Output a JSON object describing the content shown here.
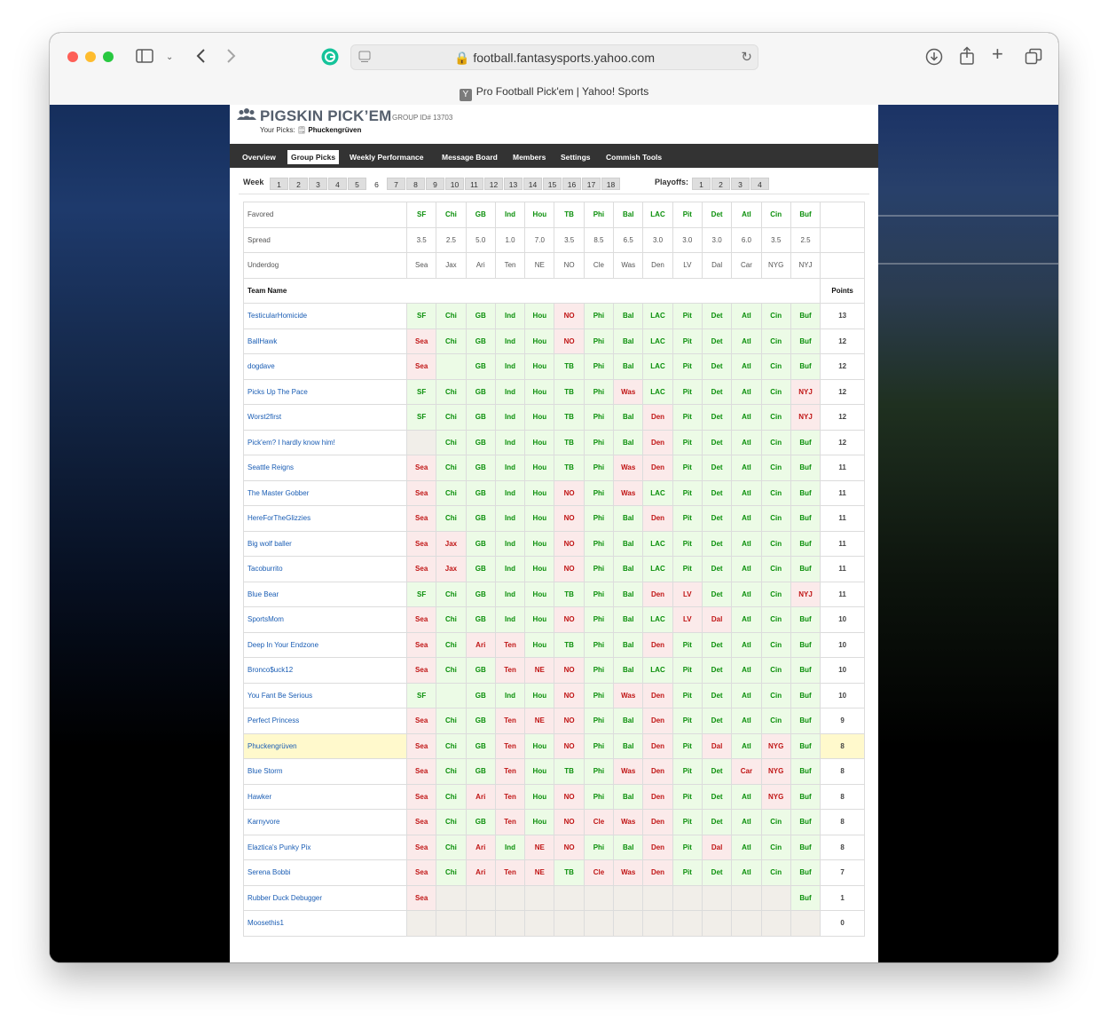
{
  "browser": {
    "url": "football.fantasysports.yahoo.com",
    "tab_title": "Pro Football Pick'em | Yahoo! Sports",
    "tab_favicon": "Y"
  },
  "header": {
    "title": "PIGSKIN PICK’EM",
    "group_id": "GROUP ID# 13703",
    "your_picks_label": "Your Picks:",
    "your_picks_name": "Phuckengrüven"
  },
  "nav": [
    "Overview",
    "Group Picks",
    "Weekly Performance",
    "Message Board",
    "Members",
    "Settings",
    "Commish Tools"
  ],
  "nav_active": "Group Picks",
  "weeks": {
    "label": "Week",
    "items": [
      "1",
      "2",
      "3",
      "4",
      "5",
      "6",
      "7",
      "8",
      "9",
      "10",
      "11",
      "12",
      "13",
      "14",
      "15",
      "16",
      "17",
      "18"
    ],
    "current": "6",
    "playoffs_label": "Playoffs:",
    "playoffs": [
      "1",
      "2",
      "3",
      "4"
    ]
  },
  "table": {
    "favored_label": "Favored",
    "spread_label": "Spread",
    "underdog_label": "Underdog",
    "team_name_header": "Team Name",
    "points_header": "Points",
    "favored": [
      "SF",
      "Chi",
      "GB",
      "Ind",
      "Hou",
      "TB",
      "Phi",
      "Bal",
      "LAC",
      "Pit",
      "Det",
      "Atl",
      "Cin",
      "Buf"
    ],
    "spread": [
      "3.5",
      "2.5",
      "5.0",
      "1.0",
      "7.0",
      "3.5",
      "8.5",
      "6.5",
      "3.0",
      "3.0",
      "3.0",
      "6.0",
      "3.5",
      "2.5"
    ],
    "underdog": [
      "Sea",
      "Jax",
      "Ari",
      "Ten",
      "NE",
      "NO",
      "Cle",
      "Was",
      "Den",
      "LV",
      "Dal",
      "Car",
      "NYG",
      "NYJ"
    ],
    "rows": [
      {
        "name": "TesticularHomicide",
        "points": "13",
        "picks": [
          "SF",
          "Chi",
          "GB",
          "Ind",
          "Hou",
          "NO",
          "Phi",
          "Bal",
          "LAC",
          "Pit",
          "Det",
          "Atl",
          "Cin",
          "Buf"
        ],
        "result": [
          "w",
          "w",
          "w",
          "w",
          "w",
          "l",
          "w",
          "w",
          "w",
          "w",
          "w",
          "w",
          "w",
          "w"
        ]
      },
      {
        "name": "BallHawk",
        "points": "12",
        "picks": [
          "Sea",
          "Chi",
          "GB",
          "Ind",
          "Hou",
          "NO",
          "Phi",
          "Bal",
          "LAC",
          "Pit",
          "Det",
          "Atl",
          "Cin",
          "Buf"
        ],
        "result": [
          "l",
          "w",
          "w",
          "w",
          "w",
          "l",
          "w",
          "w",
          "w",
          "w",
          "w",
          "w",
          "w",
          "w"
        ]
      },
      {
        "name": "dogdave",
        "points": "12",
        "picks": [
          "Sea",
          "",
          "GB",
          "Ind",
          "Hou",
          "TB",
          "Phi",
          "Bal",
          "LAC",
          "Pit",
          "Det",
          "Atl",
          "Cin",
          "Buf"
        ],
        "result": [
          "l",
          "w",
          "w",
          "w",
          "w",
          "w",
          "w",
          "w",
          "w",
          "w",
          "w",
          "w",
          "w",
          "w"
        ]
      },
      {
        "name": "Picks Up The Pace",
        "points": "12",
        "picks": [
          "SF",
          "Chi",
          "GB",
          "Ind",
          "Hou",
          "TB",
          "Phi",
          "Was",
          "LAC",
          "Pit",
          "Det",
          "Atl",
          "Cin",
          "NYJ"
        ],
        "result": [
          "w",
          "w",
          "w",
          "w",
          "w",
          "w",
          "w",
          "l",
          "w",
          "w",
          "w",
          "w",
          "w",
          "l"
        ]
      },
      {
        "name": "Worst2first",
        "points": "12",
        "picks": [
          "SF",
          "Chi",
          "GB",
          "Ind",
          "Hou",
          "TB",
          "Phi",
          "Bal",
          "Den",
          "Pit",
          "Det",
          "Atl",
          "Cin",
          "NYJ"
        ],
        "result": [
          "w",
          "w",
          "w",
          "w",
          "w",
          "w",
          "w",
          "w",
          "l",
          "w",
          "w",
          "w",
          "w",
          "l"
        ]
      },
      {
        "name": "Pick'em? I hardly know him!",
        "points": "12",
        "picks": [
          "",
          "Chi",
          "GB",
          "Ind",
          "Hou",
          "TB",
          "Phi",
          "Bal",
          "Den",
          "Pit",
          "Det",
          "Atl",
          "Cin",
          "Buf"
        ],
        "result": [
          "e",
          "w",
          "w",
          "w",
          "w",
          "w",
          "w",
          "w",
          "l",
          "w",
          "w",
          "w",
          "w",
          "w"
        ]
      },
      {
        "name": "Seattle Reigns",
        "points": "11",
        "picks": [
          "Sea",
          "Chi",
          "GB",
          "Ind",
          "Hou",
          "TB",
          "Phi",
          "Was",
          "Den",
          "Pit",
          "Det",
          "Atl",
          "Cin",
          "Buf"
        ],
        "result": [
          "l",
          "w",
          "w",
          "w",
          "w",
          "w",
          "w",
          "l",
          "l",
          "w",
          "w",
          "w",
          "w",
          "w"
        ]
      },
      {
        "name": "The Master Gobber",
        "points": "11",
        "picks": [
          "Sea",
          "Chi",
          "GB",
          "Ind",
          "Hou",
          "NO",
          "Phi",
          "Was",
          "LAC",
          "Pit",
          "Det",
          "Atl",
          "Cin",
          "Buf"
        ],
        "result": [
          "l",
          "w",
          "w",
          "w",
          "w",
          "l",
          "w",
          "l",
          "w",
          "w",
          "w",
          "w",
          "w",
          "w"
        ]
      },
      {
        "name": "HereForTheGlizzies",
        "points": "11",
        "picks": [
          "Sea",
          "Chi",
          "GB",
          "Ind",
          "Hou",
          "NO",
          "Phi",
          "Bal",
          "Den",
          "Pit",
          "Det",
          "Atl",
          "Cin",
          "Buf"
        ],
        "result": [
          "l",
          "w",
          "w",
          "w",
          "w",
          "l",
          "w",
          "w",
          "l",
          "w",
          "w",
          "w",
          "w",
          "w"
        ]
      },
      {
        "name": "Big wolf baller",
        "points": "11",
        "picks": [
          "Sea",
          "Jax",
          "GB",
          "Ind",
          "Hou",
          "NO",
          "Phi",
          "Bal",
          "LAC",
          "Pit",
          "Det",
          "Atl",
          "Cin",
          "Buf"
        ],
        "result": [
          "l",
          "l",
          "w",
          "w",
          "w",
          "l",
          "w",
          "w",
          "w",
          "w",
          "w",
          "w",
          "w",
          "w"
        ]
      },
      {
        "name": "Tacoburrito",
        "points": "11",
        "picks": [
          "Sea",
          "Jax",
          "GB",
          "Ind",
          "Hou",
          "NO",
          "Phi",
          "Bal",
          "LAC",
          "Pit",
          "Det",
          "Atl",
          "Cin",
          "Buf"
        ],
        "result": [
          "l",
          "l",
          "w",
          "w",
          "w",
          "l",
          "w",
          "w",
          "w",
          "w",
          "w",
          "w",
          "w",
          "w"
        ]
      },
      {
        "name": "Blue Bear",
        "points": "11",
        "picks": [
          "SF",
          "Chi",
          "GB",
          "Ind",
          "Hou",
          "TB",
          "Phi",
          "Bal",
          "Den",
          "LV",
          "Det",
          "Atl",
          "Cin",
          "NYJ"
        ],
        "result": [
          "w",
          "w",
          "w",
          "w",
          "w",
          "w",
          "w",
          "w",
          "l",
          "l",
          "w",
          "w",
          "w",
          "l"
        ]
      },
      {
        "name": "SportsMom",
        "points": "10",
        "picks": [
          "Sea",
          "Chi",
          "GB",
          "Ind",
          "Hou",
          "NO",
          "Phi",
          "Bal",
          "LAC",
          "LV",
          "Dal",
          "Atl",
          "Cin",
          "Buf"
        ],
        "result": [
          "l",
          "w",
          "w",
          "w",
          "w",
          "l",
          "w",
          "w",
          "w",
          "l",
          "l",
          "w",
          "w",
          "w"
        ]
      },
      {
        "name": "Deep In Your Endzone",
        "points": "10",
        "picks": [
          "Sea",
          "Chi",
          "Ari",
          "Ten",
          "Hou",
          "TB",
          "Phi",
          "Bal",
          "Den",
          "Pit",
          "Det",
          "Atl",
          "Cin",
          "Buf"
        ],
        "result": [
          "l",
          "w",
          "l",
          "l",
          "w",
          "w",
          "w",
          "w",
          "l",
          "w",
          "w",
          "w",
          "w",
          "w"
        ]
      },
      {
        "name": "Bronco$uck12",
        "points": "10",
        "picks": [
          "Sea",
          "Chi",
          "GB",
          "Ten",
          "NE",
          "NO",
          "Phi",
          "Bal",
          "LAC",
          "Pit",
          "Det",
          "Atl",
          "Cin",
          "Buf"
        ],
        "result": [
          "l",
          "w",
          "w",
          "l",
          "l",
          "l",
          "w",
          "w",
          "w",
          "w",
          "w",
          "w",
          "w",
          "w"
        ]
      },
      {
        "name": "You Fant Be Serious",
        "points": "10",
        "picks": [
          "SF",
          "",
          "GB",
          "Ind",
          "Hou",
          "NO",
          "Phi",
          "Was",
          "Den",
          "Pit",
          "Det",
          "Atl",
          "Cin",
          "Buf"
        ],
        "result": [
          "w",
          "w",
          "w",
          "w",
          "w",
          "l",
          "w",
          "l",
          "l",
          "w",
          "w",
          "w",
          "w",
          "w"
        ]
      },
      {
        "name": "Perfect Princess",
        "points": "9",
        "picks": [
          "Sea",
          "Chi",
          "GB",
          "Ten",
          "NE",
          "NO",
          "Phi",
          "Bal",
          "Den",
          "Pit",
          "Det",
          "Atl",
          "Cin",
          "Buf"
        ],
        "result": [
          "l",
          "w",
          "w",
          "l",
          "l",
          "l",
          "w",
          "w",
          "l",
          "w",
          "w",
          "w",
          "w",
          "w"
        ]
      },
      {
        "name": "Phuckengrüven",
        "points": "8",
        "me": true,
        "picks": [
          "Sea",
          "Chi",
          "GB",
          "Ten",
          "Hou",
          "NO",
          "Phi",
          "Bal",
          "Den",
          "Pit",
          "Dal",
          "Atl",
          "NYG",
          "Buf"
        ],
        "result": [
          "l",
          "w",
          "w",
          "l",
          "w",
          "l",
          "w",
          "w",
          "l",
          "w",
          "l",
          "w",
          "l",
          "w"
        ]
      },
      {
        "name": "Blue Storm",
        "points": "8",
        "picks": [
          "Sea",
          "Chi",
          "GB",
          "Ten",
          "Hou",
          "TB",
          "Phi",
          "Was",
          "Den",
          "Pit",
          "Det",
          "Car",
          "NYG",
          "Buf"
        ],
        "result": [
          "l",
          "w",
          "w",
          "l",
          "w",
          "w",
          "w",
          "l",
          "l",
          "w",
          "w",
          "l",
          "l",
          "w"
        ]
      },
      {
        "name": "Hawker",
        "points": "8",
        "picks": [
          "Sea",
          "Chi",
          "Ari",
          "Ten",
          "Hou",
          "NO",
          "Phi",
          "Bal",
          "Den",
          "Pit",
          "Det",
          "Atl",
          "NYG",
          "Buf"
        ],
        "result": [
          "l",
          "w",
          "l",
          "l",
          "w",
          "l",
          "w",
          "w",
          "l",
          "w",
          "w",
          "w",
          "l",
          "w"
        ]
      },
      {
        "name": "Karnyvore",
        "points": "8",
        "picks": [
          "Sea",
          "Chi",
          "GB",
          "Ten",
          "Hou",
          "NO",
          "Cle",
          "Was",
          "Den",
          "Pit",
          "Det",
          "Atl",
          "Cin",
          "Buf"
        ],
        "result": [
          "l",
          "w",
          "w",
          "l",
          "w",
          "l",
          "l",
          "l",
          "l",
          "w",
          "w",
          "w",
          "w",
          "w"
        ]
      },
      {
        "name": "Elaztica's Punky Pix",
        "points": "8",
        "picks": [
          "Sea",
          "Chi",
          "Ari",
          "Ind",
          "NE",
          "NO",
          "Phi",
          "Bal",
          "Den",
          "Pit",
          "Dal",
          "Atl",
          "Cin",
          "Buf"
        ],
        "result": [
          "l",
          "w",
          "l",
          "w",
          "l",
          "l",
          "w",
          "w",
          "l",
          "w",
          "l",
          "w",
          "w",
          "w"
        ]
      },
      {
        "name": "Serena Bobbi",
        "points": "7",
        "picks": [
          "Sea",
          "Chi",
          "Ari",
          "Ten",
          "NE",
          "TB",
          "Cle",
          "Was",
          "Den",
          "Pit",
          "Det",
          "Atl",
          "Cin",
          "Buf"
        ],
        "result": [
          "l",
          "w",
          "l",
          "l",
          "l",
          "w",
          "l",
          "l",
          "l",
          "w",
          "w",
          "w",
          "w",
          "w"
        ]
      },
      {
        "name": "Rubber Duck Debugger",
        "points": "1",
        "picks": [
          "Sea",
          "",
          "",
          "",
          "",
          "",
          "",
          "",
          "",
          "",
          "",
          "",
          "",
          "Buf"
        ],
        "result": [
          "l",
          "e",
          "e",
          "e",
          "e",
          "e",
          "e",
          "e",
          "e",
          "e",
          "e",
          "e",
          "e",
          "w"
        ]
      },
      {
        "name": "Moosethis1",
        "points": "0",
        "picks": [
          "",
          "",
          "",
          "",
          "",
          "",
          "",
          "",
          "",
          "",
          "",
          "",
          "",
          ""
        ],
        "result": [
          "e",
          "e",
          "e",
          "e",
          "e",
          "e",
          "e",
          "e",
          "e",
          "e",
          "e",
          "e",
          "e",
          "e"
        ]
      }
    ]
  },
  "colors": {
    "win_text": "#0a8f0a",
    "win_bg": "#ecfbe6",
    "loss_text": "#c01515",
    "loss_bg": "#fbeaea",
    "highlight_row": "#fff9cc",
    "nav_bg": "#333333"
  }
}
